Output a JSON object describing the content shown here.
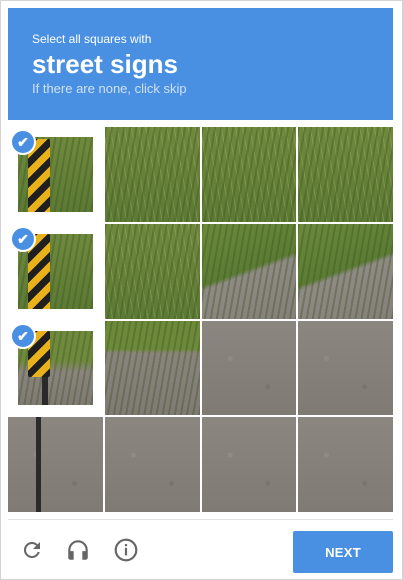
{
  "header": {
    "instruction": "Select all squares with",
    "target": "street signs",
    "hint": "If there are none, click skip"
  },
  "grid": {
    "rows": 4,
    "columns": 4,
    "selected_tiles": [
      0,
      4,
      8
    ],
    "check_glyph": "✔"
  },
  "footer": {
    "reload_icon": "reload-icon",
    "audio_icon": "headphones-icon",
    "info_icon": "info-icon",
    "next_label": "NEXT"
  },
  "colors": {
    "accent": "#4a90e2",
    "icon_gray": "#666666"
  }
}
